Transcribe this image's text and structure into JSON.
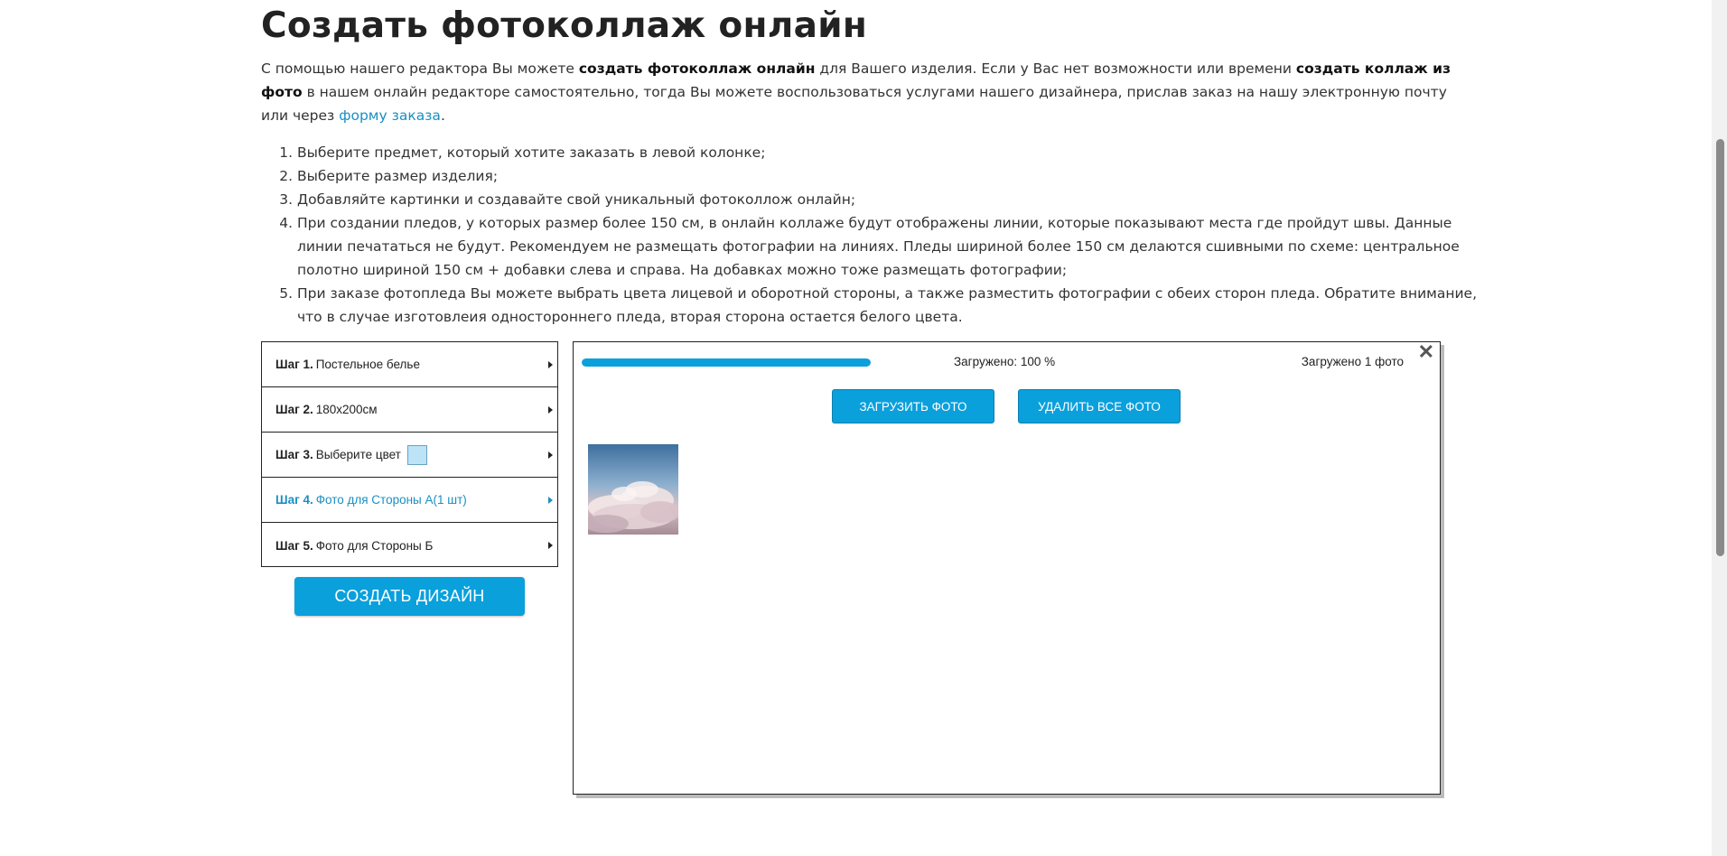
{
  "page": {
    "title": "Создать фотоколлаж онлайн",
    "intro": {
      "part1": "С помощью нашего редактора Вы можете ",
      "bold1": "создать фотоколлаж онлайн",
      "part2": " для Вашего изделия. Если у Вас нет возможности или времени ",
      "bold2": "создать коллаж из фото",
      "part3": " в нашем онлайн редакторе самостоятельно, тогда Вы можете воспользоваться услугами нашего дизайнера, прислав заказ на нашу электронную почту или через ",
      "link": "форму заказа",
      "part4": "."
    },
    "steps": [
      "Выберите предмет, который хотите заказать в левой колонке;",
      "Выберите размер изделия;",
      "Добавляйте картинки и создавайте свой уникальный фотоколлож онлайн;",
      "При создании пледов, у которых размер более 150 см, в онлайн коллаже будут отображены линии, которые показывают места где пройдут швы. Данные линии печататься не будут. Рекомендуем не размещать фотографии на линиях. Пледы шириной более 150 см делаются сшивными по схеме: центральное полотно шириной 150 см + добавки слева и справа. На добавках можно тоже размещать фотографии;",
      "При заказе фотопледа Вы можете выбрать цвета лицевой и оборотной стороны, а также разместить фотографии с обеих сторон пледа. Обратите внимание, что в случае изготовлеия одностороннего пледа, вторая сторона остается белого цвета."
    ]
  },
  "wizard": {
    "steps": [
      {
        "label": "Шаг 1.",
        "value": "Постельное белье"
      },
      {
        "label": "Шаг 2.",
        "value": "180x200см"
      },
      {
        "label": "Шаг 3.",
        "value": "Выберите цвет"
      },
      {
        "label": "Шаг 4.",
        "value": "Фото для Стороны А(1 шт)"
      },
      {
        "label": "Шаг 5.",
        "value": "Фото для Стороны Б"
      }
    ],
    "selected_color": "#bde3f7",
    "active_step": 4,
    "create_button": "СОЗДАТЬ ДИЗАЙН"
  },
  "upload_panel": {
    "progress_percent": 100,
    "loaded_percent_text": "Загружено: 100 %",
    "loaded_count_text": "Загружено 1 фото",
    "upload_button": "ЗАГРУЗИТЬ ФОТО",
    "delete_button": "УДАЛИТЬ ВСЕ ФОТО",
    "close_symbol": "✕",
    "photos": [
      "clouds-sky-photo"
    ]
  },
  "colors": {
    "accent": "#0aa0dc",
    "link": "#1a8fc2"
  }
}
